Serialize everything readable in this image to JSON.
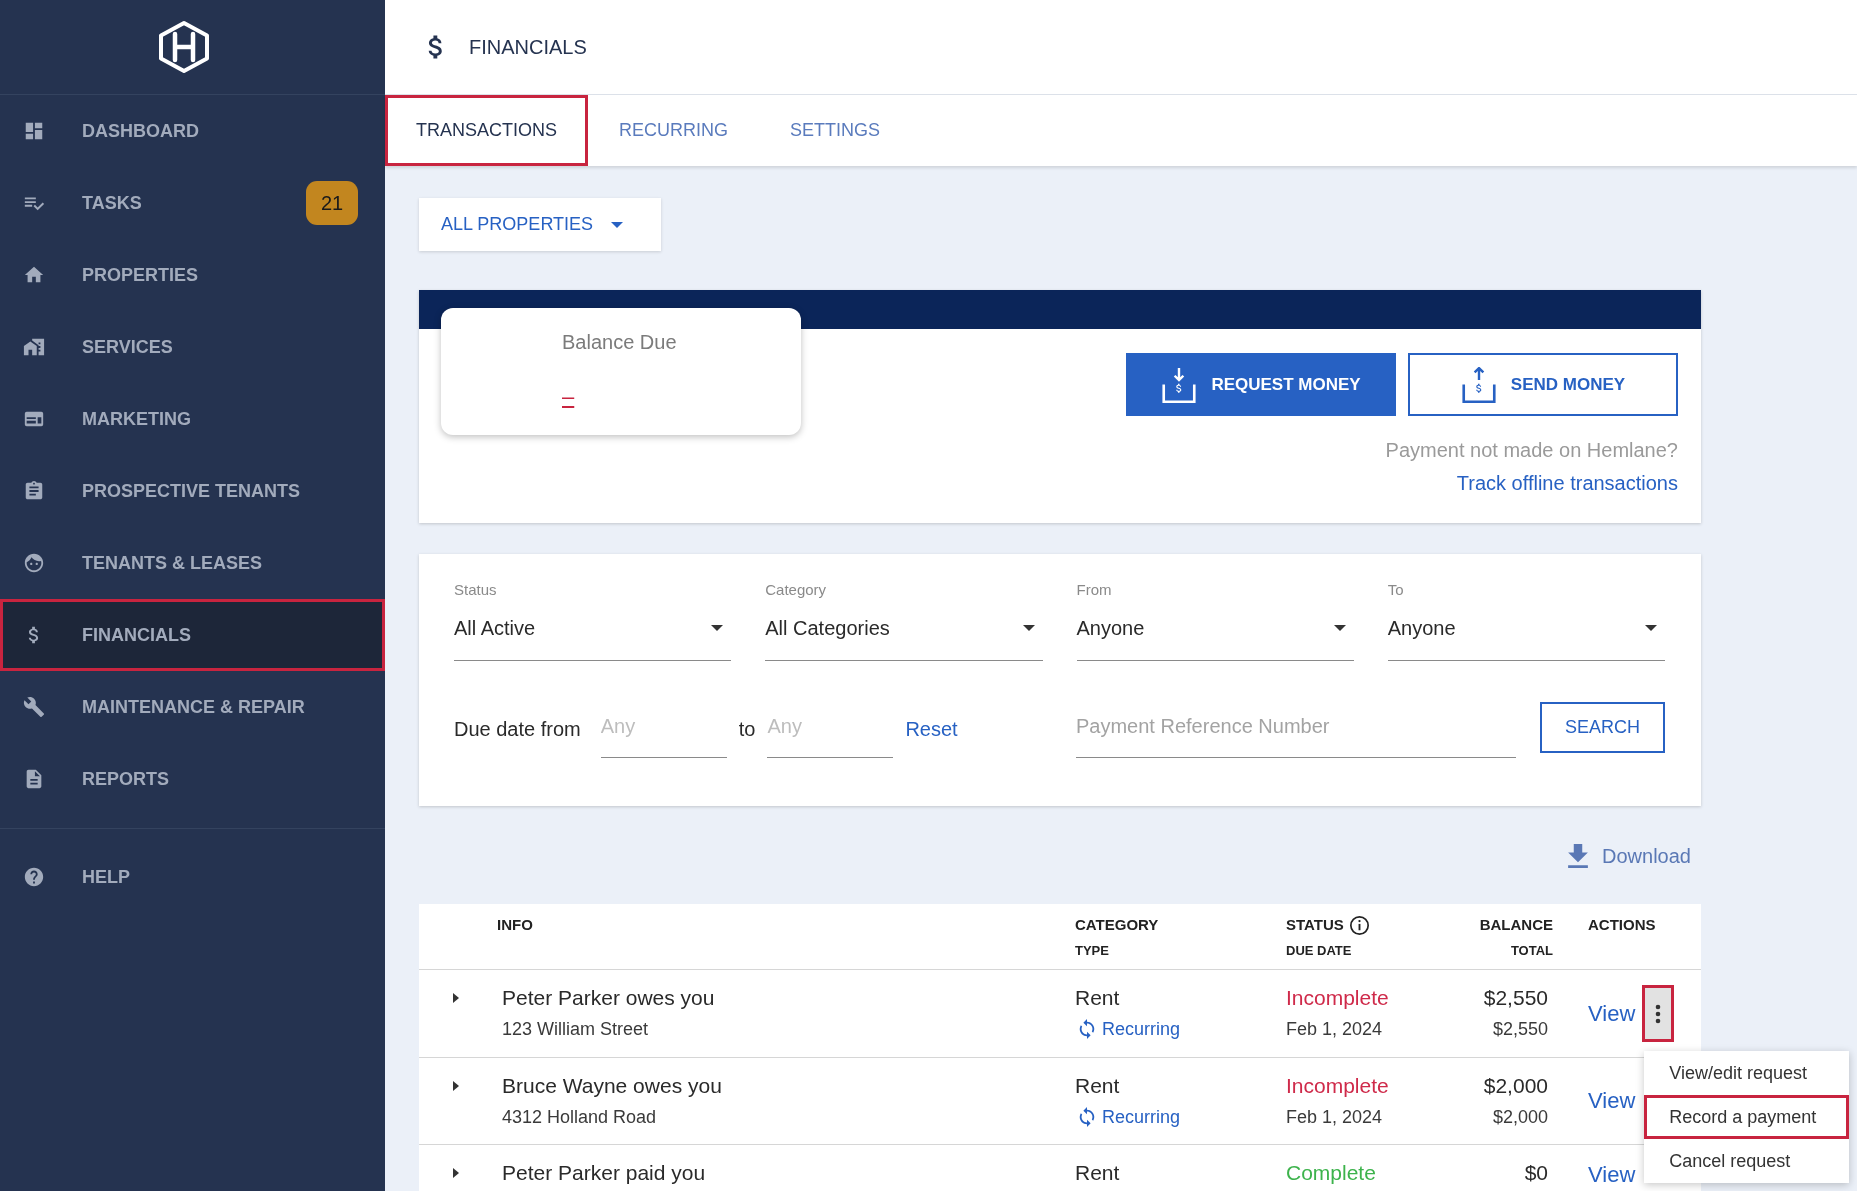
{
  "sidebar": {
    "items": [
      {
        "label": "DASHBOARD",
        "selected": false,
        "highlighted": false
      },
      {
        "label": "TASKS",
        "selected": false,
        "highlighted": false,
        "badge": "21"
      },
      {
        "label": "PROPERTIES",
        "selected": false,
        "highlighted": false
      },
      {
        "label": "SERVICES",
        "selected": false,
        "highlighted": false
      },
      {
        "label": "MARKETING",
        "selected": false,
        "highlighted": false
      },
      {
        "label": "PROSPECTIVE TENANTS",
        "selected": false,
        "highlighted": false
      },
      {
        "label": "TENANTS & LEASES",
        "selected": false,
        "highlighted": false
      },
      {
        "label": "FINANCIALS",
        "selected": true,
        "highlighted": true
      },
      {
        "label": "MAINTENANCE & REPAIR",
        "selected": false,
        "highlighted": false
      },
      {
        "label": "REPORTS",
        "selected": false,
        "highlighted": false
      }
    ],
    "footer_items": [
      {
        "label": "HELP",
        "selected": false,
        "highlighted": false
      }
    ]
  },
  "header": {
    "title": "FINANCIALS"
  },
  "tabs": [
    {
      "label": "TRANSACTIONS",
      "selected": true,
      "highlighted": true
    },
    {
      "label": "RECURRING",
      "selected": false,
      "highlighted": false
    },
    {
      "label": "SETTINGS",
      "selected": false,
      "highlighted": false
    }
  ],
  "property_filter": {
    "label": "ALL PROPERTIES"
  },
  "balance": {
    "label": "Balance Due",
    "amount": "–",
    "buttons": [
      {
        "kind": "request",
        "label": "REQUEST MONEY"
      },
      {
        "kind": "send",
        "label": "SEND MONEY"
      }
    ],
    "offline_note": "Payment not made on Hemlane?",
    "offline_link": "Track offline transactions"
  },
  "filters": {
    "selects": [
      {
        "label": "Status",
        "value": "All Active"
      },
      {
        "label": "Category",
        "value": "All Categories"
      },
      {
        "label": "From",
        "value": "Anyone"
      },
      {
        "label": "To",
        "value": "Anyone"
      }
    ],
    "due_date_label": "Due date from",
    "due_from": {
      "placeholder": "Any"
    },
    "due_to_label": "to",
    "due_to": {
      "placeholder": "Any"
    },
    "reset": "Reset",
    "reference": {
      "placeholder": "Payment Reference Number"
    },
    "search": "SEARCH"
  },
  "download": "Download",
  "table": {
    "columns": [
      {
        "label": "INFO",
        "info": false
      },
      {
        "label": "CATEGORY",
        "sublabel": "TYPE",
        "info": false
      },
      {
        "label": "STATUS",
        "sublabel": "DUE DATE",
        "info": true
      },
      {
        "label": "BALANCE",
        "sublabel": "TOTAL",
        "info": false
      },
      {
        "label": "ACTIONS",
        "info": false
      }
    ],
    "rows": [
      {
        "expanded": false,
        "title": "Peter Parker owes you",
        "address": "123 William Street",
        "category": "Rent",
        "type": "Recurring",
        "status": {
          "label": "Incomplete",
          "color": "#cf2a4a"
        },
        "due_date": "Feb 1, 2024",
        "balance": "$2,550",
        "total": "$2,550",
        "action": "View",
        "menu_button": {
          "open": true,
          "highlighted": true
        }
      },
      {
        "expanded": false,
        "title": "Bruce Wayne owes you",
        "address": "4312 Holland Road",
        "category": "Rent",
        "type": "Recurring",
        "status": {
          "label": "Incomplete",
          "color": "#cf2a4a"
        },
        "due_date": "Feb 1, 2024",
        "balance": "$2,000",
        "total": "$2,000",
        "action": "View"
      },
      {
        "expanded": false,
        "title": "Peter Parker paid you",
        "category": "Rent",
        "status": {
          "label": "Complete",
          "color": "#3db34c"
        },
        "balance": "$0",
        "action": "View"
      }
    ],
    "menu": {
      "items": [
        {
          "label": "View/edit request",
          "highlighted": false
        },
        {
          "label": "Record a payment",
          "highlighted": true
        },
        {
          "label": "Cancel request",
          "highlighted": false
        }
      ]
    }
  }
}
